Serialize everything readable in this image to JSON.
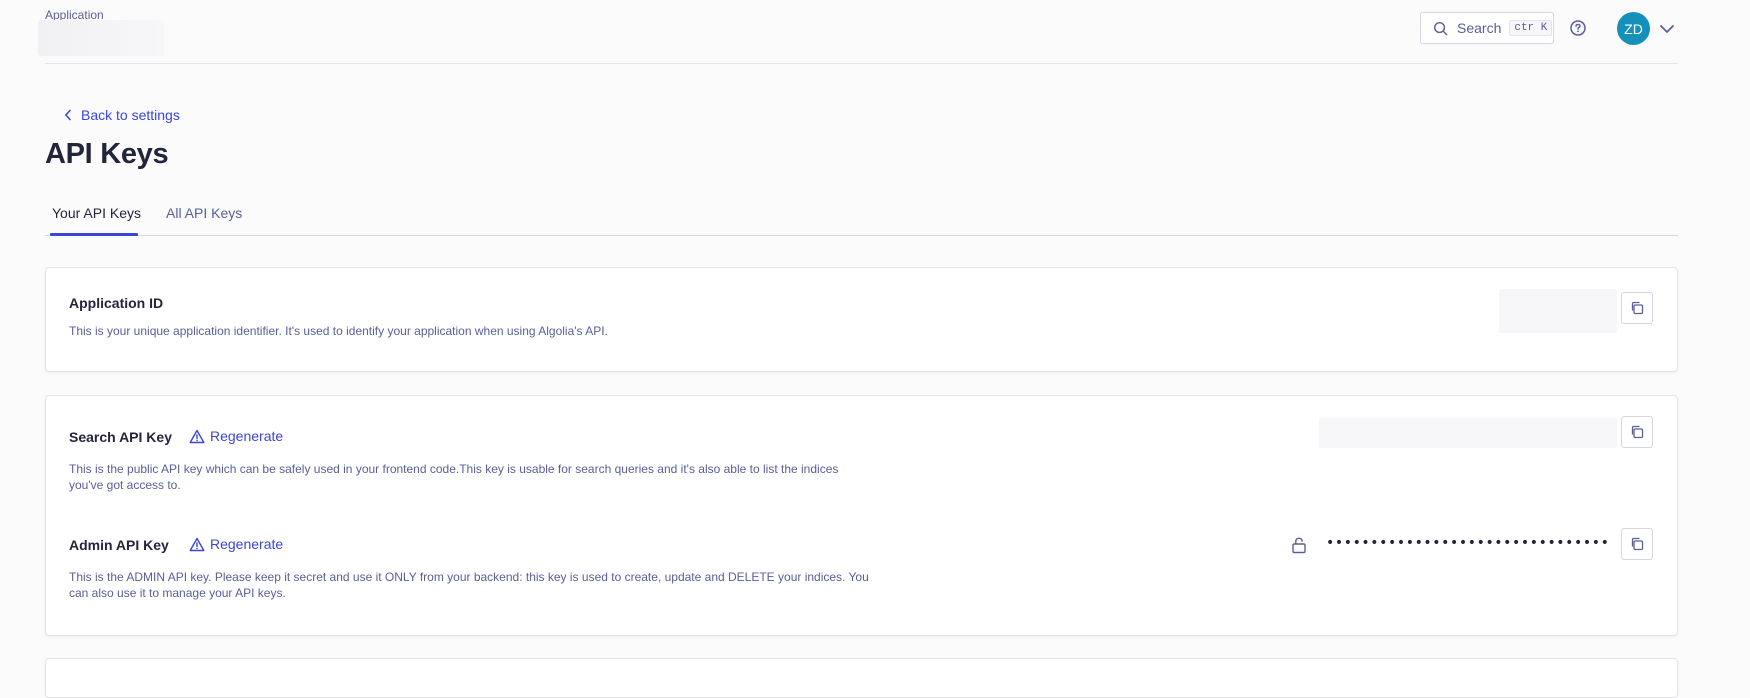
{
  "header": {
    "app_label": "Application",
    "app_name": "",
    "search_label": "Search",
    "search_shortcut": "ctr K",
    "avatar_initials": "ZD",
    "avatar_color": "#1590ba"
  },
  "back_link": {
    "label": "Back to settings",
    "icon": "chevron-left-icon"
  },
  "page_title": "API Keys",
  "tabs": [
    {
      "label": "Your API Keys",
      "active": true
    },
    {
      "label": "All API Keys",
      "active": false
    }
  ],
  "application_id": {
    "title": "Application ID",
    "description": "This is your unique application identifier. It's used to identify your application when using Algolia's API.",
    "value": ""
  },
  "search_api_key": {
    "title": "Search API Key",
    "regenerate_label": "Regenerate",
    "description_line1": "This is the public API key which can be safely used in your frontend code.This key is usable for search queries and it's also able to list the indices",
    "description_line2": "you've got access to.",
    "value": ""
  },
  "admin_api_key": {
    "title": "Admin API Key",
    "regenerate_label": "Regenerate",
    "description_line1": "This is the ADMIN API key. Please keep it secret and use it ONLY from your backend: this key is used to create, update and DELETE your indices. You",
    "description_line2": "can also use it to manage your API keys.",
    "masked_value": "••••••••••••••••••••••••••••••••"
  },
  "colors": {
    "accent": "#3a46d8",
    "text_primary": "#23263b",
    "text_secondary": "#5a5e9a",
    "border": "#e4e5ec"
  }
}
